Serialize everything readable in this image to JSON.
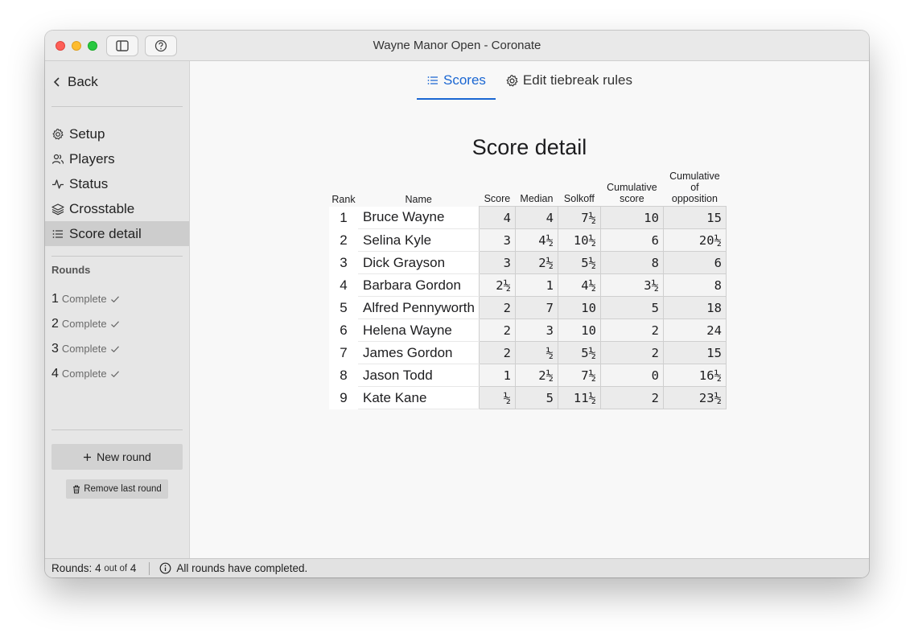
{
  "window": {
    "title": "Wayne Manor Open - Coronate"
  },
  "sidebar": {
    "back_label": "Back",
    "items": [
      {
        "label": "Setup",
        "icon": "gear-icon"
      },
      {
        "label": "Players",
        "icon": "users-icon"
      },
      {
        "label": "Status",
        "icon": "activity-icon"
      },
      {
        "label": "Crosstable",
        "icon": "layers-icon"
      },
      {
        "label": "Score detail",
        "icon": "list-icon"
      }
    ],
    "active_item": "Score detail",
    "rounds_heading": "Rounds",
    "rounds": [
      {
        "number": "1",
        "status": "Complete"
      },
      {
        "number": "2",
        "status": "Complete"
      },
      {
        "number": "3",
        "status": "Complete"
      },
      {
        "number": "4",
        "status": "Complete"
      }
    ],
    "new_round_label": "New round",
    "remove_round_label": "Remove last round"
  },
  "tabs": [
    {
      "label": "Scores",
      "icon": "list-icon",
      "active": true
    },
    {
      "label": "Edit tiebreak rules",
      "icon": "gear-icon",
      "active": false
    }
  ],
  "page_title": "Score detail",
  "table": {
    "headers": {
      "rank": "Rank",
      "name": "Name",
      "score": "Score",
      "median": "Median",
      "solkoff": "Solkoff",
      "cumulative_score": [
        "Cumulative",
        "score"
      ],
      "cumulative_opposition": [
        "Cumulative",
        "of",
        "opposition"
      ]
    },
    "rows": [
      {
        "rank": "1",
        "name": "Bruce Wayne",
        "score": "4",
        "median": "4",
        "solkoff": "7½",
        "cumulative": "10",
        "cumulative_opp": "15"
      },
      {
        "rank": "2",
        "name": "Selina Kyle",
        "score": "3",
        "median": "4½",
        "solkoff": "10½",
        "cumulative": "6",
        "cumulative_opp": "20½"
      },
      {
        "rank": "3",
        "name": "Dick Grayson",
        "score": "3",
        "median": "2½",
        "solkoff": "5½",
        "cumulative": "8",
        "cumulative_opp": "6"
      },
      {
        "rank": "4",
        "name": "Barbara Gordon",
        "score": "2½",
        "median": "1",
        "solkoff": "4½",
        "cumulative": "3½",
        "cumulative_opp": "8"
      },
      {
        "rank": "5",
        "name": "Alfred Pennyworth",
        "score": "2",
        "median": "7",
        "solkoff": "10",
        "cumulative": "5",
        "cumulative_opp": "18"
      },
      {
        "rank": "6",
        "name": "Helena Wayne",
        "score": "2",
        "median": "3",
        "solkoff": "10",
        "cumulative": "2",
        "cumulative_opp": "24"
      },
      {
        "rank": "7",
        "name": "James Gordon",
        "score": "2",
        "median": "½",
        "solkoff": "5½",
        "cumulative": "2",
        "cumulative_opp": "15"
      },
      {
        "rank": "8",
        "name": "Jason Todd",
        "score": "1",
        "median": "2½",
        "solkoff": "7½",
        "cumulative": "0",
        "cumulative_opp": "16½"
      },
      {
        "rank": "9",
        "name": "Kate Kane",
        "score": "½",
        "median": "5",
        "solkoff": "11½",
        "cumulative": "2",
        "cumulative_opp": "23½"
      }
    ]
  },
  "statusbar": {
    "rounds_label": "Rounds:",
    "rounds_current": "4",
    "rounds_out_of": "out of",
    "rounds_total": "4",
    "message": "All rounds have completed."
  }
}
